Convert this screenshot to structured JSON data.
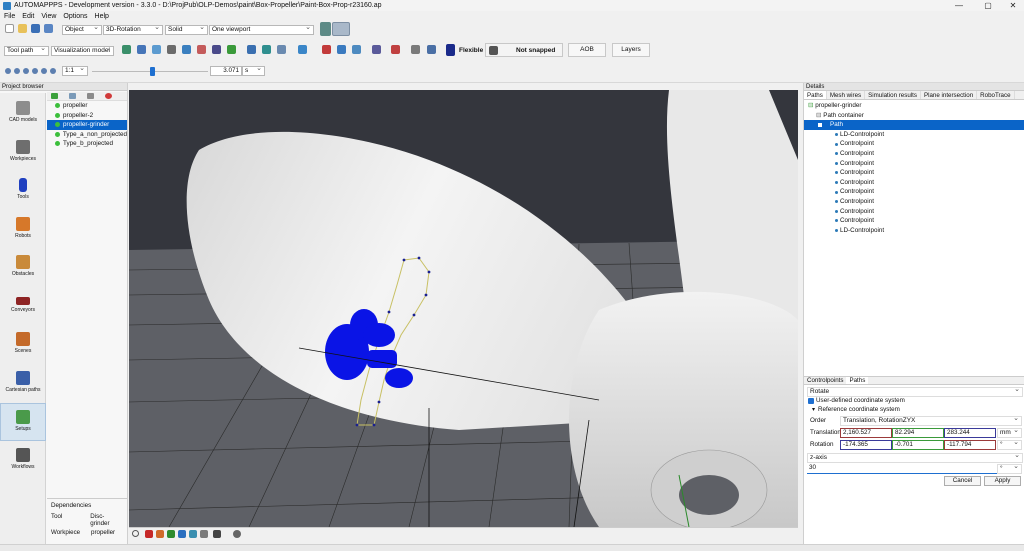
{
  "window": {
    "title": "AUTOMAPPPS - Development version - 3.3.0 - D:\\ProjPub\\OLP-Demos\\paint\\Box-Propeller\\Paint-Box-Prop-r23160.ap"
  },
  "menu": [
    "File",
    "Edit",
    "View",
    "Options",
    "Help"
  ],
  "toolbar": {
    "object_select": "Object",
    "rotation_select": "3D-Rotation",
    "shading_select": "Solid",
    "viewport_select": "One viewport",
    "toolpath_select": "Tool path",
    "visualization_select": "Visualization model",
    "flexible_label": "Flexible",
    "snapped_label": "Not snapped",
    "aob_label": "AOB",
    "layers_label": "Layers",
    "speed_select": "1:1",
    "time_value": "3.071",
    "time_unit": "s",
    "slider_fraction": 0.52
  },
  "project_browser": {
    "title": "Project browser",
    "sidebar": [
      "CAD models",
      "Workpieces",
      "Tools",
      "Robots",
      "Obstacles",
      "Conveyors",
      "Scenes",
      "Cartesian paths",
      "Setups",
      "Workflows"
    ],
    "active_sidebar": "Setups",
    "tree": [
      "propeller",
      "propeller-2",
      "propeller-grinder",
      "Type_a_non_projected",
      "Type_b_projected"
    ],
    "selected_tree": "propeller-grinder",
    "dependencies_title": "Dependencies",
    "dependencies": [
      {
        "kind": "Tool",
        "value": "Disc-grinder"
      },
      {
        "kind": "Workpiece",
        "value": "propeller"
      }
    ]
  },
  "details": {
    "title": "Details",
    "tabs": [
      "Paths",
      "Mesh wires",
      "Simulation results",
      "Plane intersection",
      "RoboTrace"
    ],
    "active_tab": "Paths",
    "tree": {
      "root": "propeller-grinder",
      "container": "Path container",
      "path": "Path",
      "points": [
        "LD-Controlpoint",
        "Controlpoint",
        "Controlpoint",
        "Controlpoint",
        "Controlpoint",
        "Controlpoint",
        "Controlpoint",
        "Controlpoint",
        "Controlpoint",
        "Controlpoint",
        "LD-Controlpoint"
      ]
    },
    "lower_tabs": [
      "Controlpoints",
      "Paths"
    ],
    "lower_active": "Paths",
    "operation": "Rotate",
    "user_defined_label": "User-defined coordinate system",
    "user_defined_checked": true,
    "reference_label": "Reference coordinate system",
    "order_label": "Order",
    "order_value": "Translation, RotationZYX",
    "translation_label": "Translation",
    "translation": [
      "2,160.527",
      "82.294",
      "283.244"
    ],
    "translation_unit": "mm",
    "rotation_label": "Rotation",
    "rotation": [
      "-174.365",
      "-0.701",
      "-117.794"
    ],
    "rotation_unit": "°",
    "axis_select": "z-axis",
    "angle_value": "30",
    "angle_unit": "°",
    "cancel_label": "Cancel",
    "apply_label": "Apply"
  },
  "colors": {
    "selection": "#0a64c8",
    "robot": "#0a14e6",
    "path_line": "#c8c064",
    "background": "#3a3c44"
  }
}
